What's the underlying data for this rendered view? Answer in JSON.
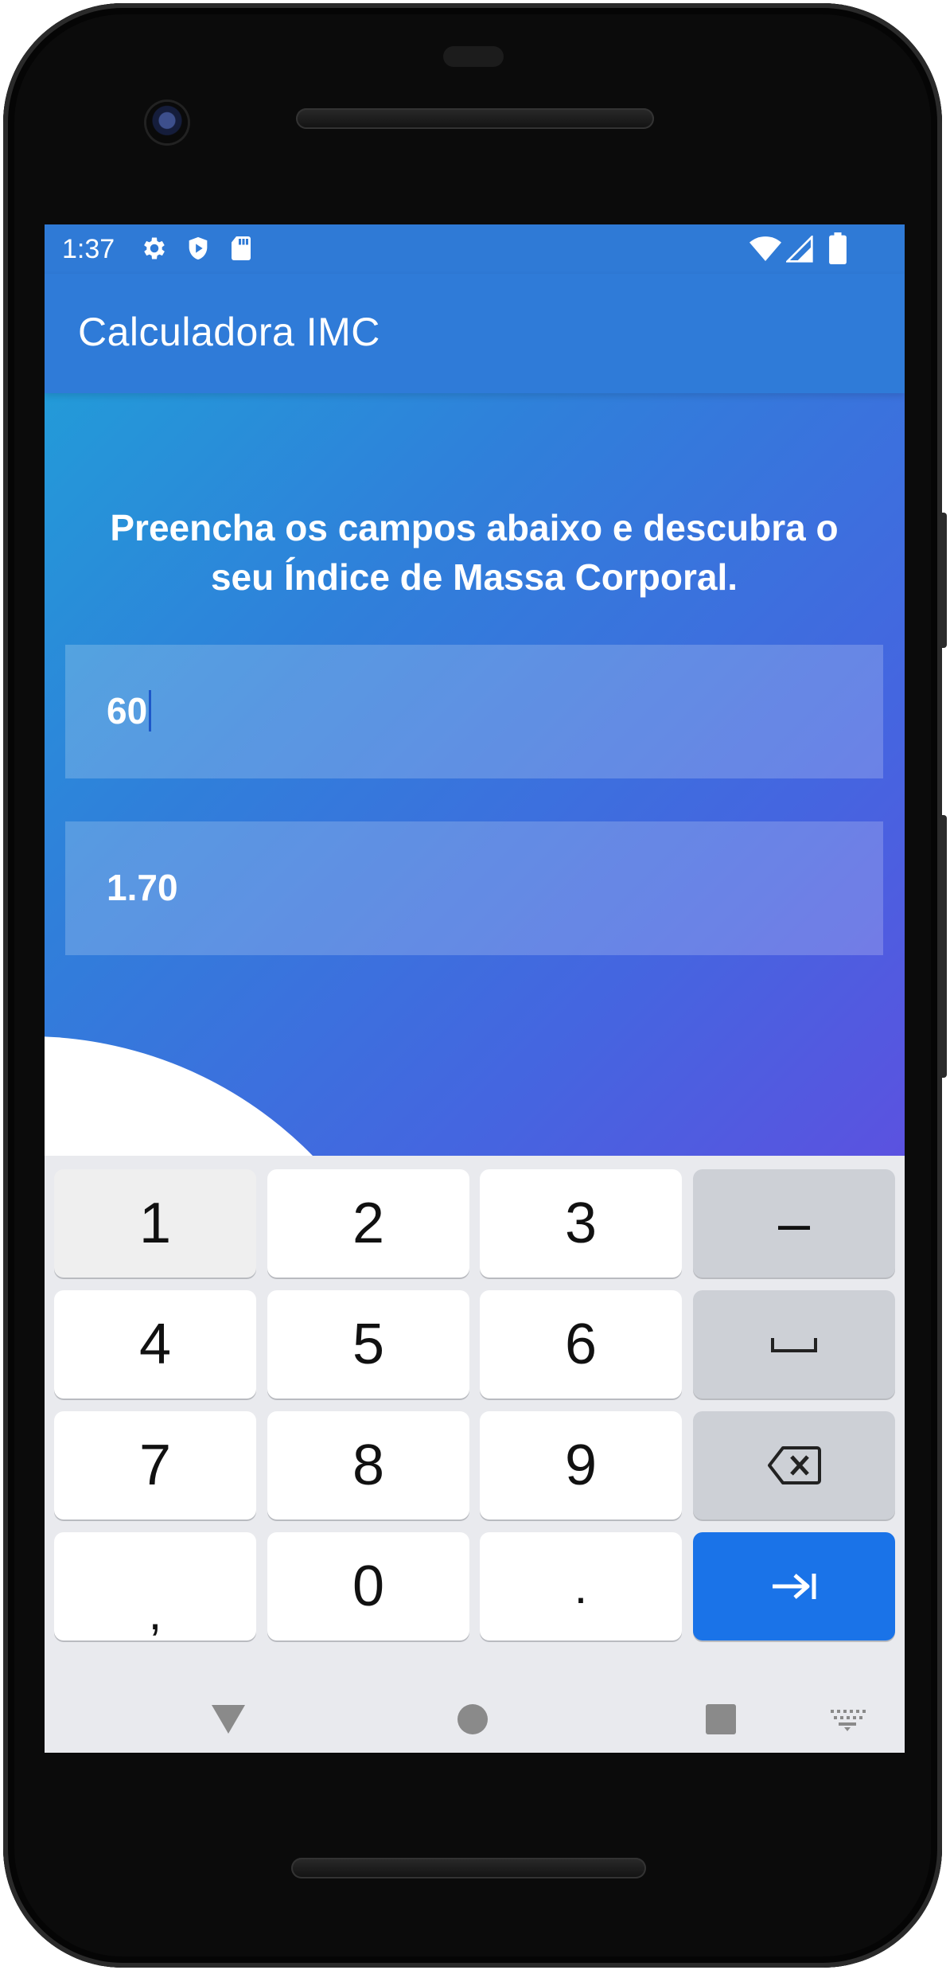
{
  "status_bar": {
    "time": "1:37",
    "left_icons": [
      "gear-icon",
      "shield-play-icon",
      "sd-card-icon"
    ],
    "right_icons": [
      "wifi-icon",
      "cell-signal-icon",
      "battery-icon"
    ]
  },
  "app_bar": {
    "title": "Calculadora IMC"
  },
  "main": {
    "headline": "Preencha os campos abaixo e descubra o seu Índice de Massa Corporal.",
    "weight_field": {
      "value": "60"
    },
    "height_field": {
      "value": "1.70"
    }
  },
  "keyboard": {
    "rows": [
      [
        "1",
        "2",
        "3",
        "–"
      ],
      [
        "4",
        "5",
        "6",
        "space"
      ],
      [
        "7",
        "8",
        "9",
        "backspace"
      ],
      [
        ",",
        "0",
        ".",
        "next"
      ]
    ],
    "labels": {
      "k1": "1",
      "k2": "2",
      "k3": "3",
      "dash": "–",
      "k4": "4",
      "k5": "5",
      "k6": "6",
      "k7": "7",
      "k8": "8",
      "k9": "9",
      "comma": ",",
      "k0": "0",
      "dot": "."
    },
    "action_color": "#1a73e8"
  },
  "nav_bar": {
    "icons": [
      "back-triangle-icon",
      "home-circle-icon",
      "recents-square-icon",
      "keyboard-switch-icon"
    ]
  },
  "colors": {
    "gradient_start": "#1fa3d8",
    "gradient_end": "#5b52e0",
    "app_bar": "#2f7bd8"
  }
}
